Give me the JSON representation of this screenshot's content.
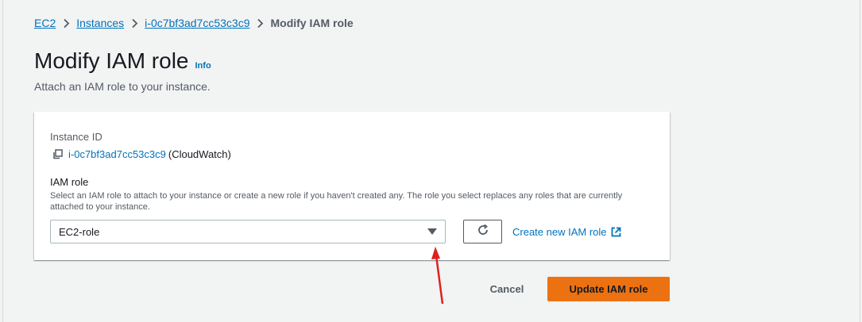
{
  "breadcrumb": {
    "items": [
      "EC2",
      "Instances",
      "i-0c7bf3ad7cc53c3c9"
    ],
    "current": "Modify IAM role"
  },
  "page": {
    "title": "Modify IAM role",
    "info": "Info",
    "description": "Attach an IAM role to your instance."
  },
  "form": {
    "instance_id_label": "Instance ID",
    "instance_id": "i-0c7bf3ad7cc53c3c9",
    "instance_name": "(CloudWatch)",
    "iam_role_label": "IAM role",
    "iam_role_description": "Select an IAM role to attach to your instance or create a new role if you haven't created any. The role you select replaces any roles that are currently attached to your instance.",
    "iam_role_value": "EC2-role",
    "create_role_link": "Create new IAM role"
  },
  "actions": {
    "cancel": "Cancel",
    "submit": "Update IAM role"
  },
  "colors": {
    "link": "#0073bb",
    "primary": "#ec7211",
    "annotation_arrow": "#e02020"
  }
}
